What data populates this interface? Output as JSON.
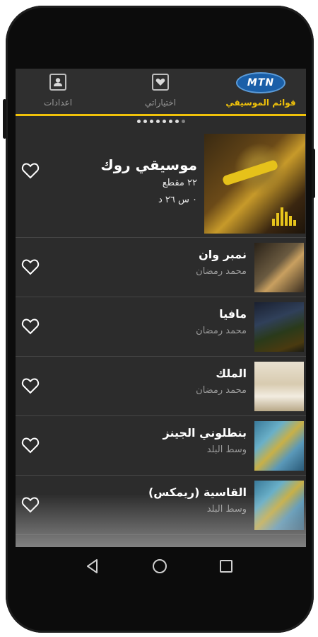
{
  "app": {
    "logo_text": "MTN"
  },
  "tabs": [
    {
      "label": "قوائم الموسيقي",
      "icon": "mtn-logo",
      "active": true
    },
    {
      "label": "اختياراتي",
      "icon": "heart-box-icon",
      "active": false
    },
    {
      "label": "اعدادات",
      "icon": "user-box-icon",
      "active": false
    }
  ],
  "pager": {
    "count": 8,
    "active_index": 0
  },
  "featured": {
    "title": "موسيقي روك",
    "count": "٢٢ مقطع",
    "duration": "٠ س ٢٦ د",
    "art": "rock-guitarist-art",
    "favorite_icon": "heart-outline-icon"
  },
  "songs": [
    {
      "title": "نمبر وان",
      "artist": "محمد رمضان",
      "art": "number-one-cover"
    },
    {
      "title": "مافيا",
      "artist": "محمد رمضان",
      "art": "mafia-cover"
    },
    {
      "title": "الملك",
      "artist": "محمد رمضان",
      "art": "el-malek-cover"
    },
    {
      "title": "بنطلوني الجينز",
      "artist": "وسط البلد",
      "art": "wust-el-balad-cover"
    },
    {
      "title": "القاسية (ريمكس)",
      "artist": "وسط البلد",
      "art": "wust-el-balad-cover"
    }
  ],
  "system_nav": {
    "back_icon": "back-triangle-icon",
    "home_icon": "home-circle-icon",
    "recents_icon": "recents-square-icon"
  },
  "colors": {
    "accent": "#f0c20a",
    "background": "#2c2c2c",
    "muted_text": "#9a9a9a"
  }
}
